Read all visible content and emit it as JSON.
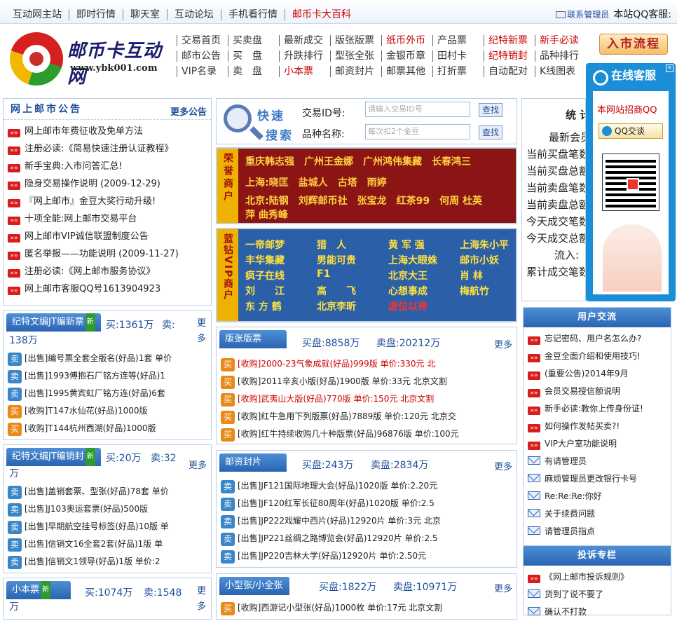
{
  "topbar": {
    "links": [
      "互动网主站",
      "即时行情",
      "聊天室",
      "互动论坛",
      "手机看行情",
      "邮币卡大百科"
    ],
    "admin_contact": "联系管理员",
    "qq_service": "本站QQ客服:"
  },
  "logo": {
    "title": "邮币卡互动网",
    "url": "www.ybk001.com"
  },
  "mainnav": {
    "rows": [
      [
        "交易首页",
        "买卖盘",
        "最新成交",
        "版张版票",
        "纸币外币",
        "产品票",
        "纪特新票",
        "新手必读"
      ],
      [
        "邮市公告",
        "买　盘",
        "升跌排行",
        "型张全张",
        "金银币章",
        "田村卡",
        "纪特销封",
        "品种排行"
      ],
      [
        "VIP名录",
        "卖　盘",
        "小本票",
        "邮资封片",
        "邮票其他",
        "打折票",
        "自动配对",
        "K线图表"
      ]
    ],
    "red": [
      "纸币外币",
      "纪特新票",
      "新手必读",
      "纪特销封",
      "小本票"
    ]
  },
  "entry_button": "入市流程",
  "notice": {
    "title": "网上邮市公告",
    "more": "更多公告",
    "items": [
      "网上邮市年费征收及免单方法",
      "注册必读:《简易快速注册认证教程》",
      "新手宝典:入市问答汇总!",
      "隐身交易操作说明 (2009-12-29)",
      "『网上邮市』金豆大奖行动升级!",
      "十项全能:网上邮市交易平台",
      "网上邮市VIP诚信联盟制度公告",
      "匿名举报——功能说明 (2009-11-27)",
      "注册必读:《网上邮市服务协议》",
      "网上邮市客服QQ号1613904923"
    ]
  },
  "search": {
    "quick": "快速",
    "search": "搜索",
    "id_label": "交易ID号:",
    "id_placeholder": "请输入交易ID号",
    "name_label": "品种名称:",
    "name_placeholder": "每次扣2个金豆",
    "btn": "查找"
  },
  "honor": {
    "band": "荣誉商户",
    "rows": [
      "重庆韩志强　广州王金娜　广州鸿伟集藏　长春鸿三",
      "上海:晓匡　盐城人　古塔　雨婷",
      "北京:陆钢　刘辉邮币社　张宝龙　红茶99　何周 杜英",
      "萍 曲秀峰"
    ]
  },
  "vip": {
    "band": "蓝钻VIP商户",
    "names": [
      "一帝邮梦",
      "猎　人",
      "黄 军 强",
      "上海朱小平",
      "丰华集藏",
      "男能可贵",
      "上海大眼姝",
      "邮市小妖",
      "疯子在线",
      "F1",
      "北京大王",
      "肖 林",
      "刘　　江",
      "高　　飞",
      "心想事成",
      "梅航竹",
      "东 方 鹤",
      "北京李昕",
      "虚位以待"
    ]
  },
  "stats": {
    "title": "统 计",
    "rows": [
      "最新会员:",
      "当前买盘笔数",
      "当前买盘总额",
      "当前卖盘笔数",
      "当前卖盘总额",
      "今天成交笔数",
      "今天成交总额",
      "流入:",
      "累计成交笔数"
    ]
  },
  "qq": {
    "title": "在线客服",
    "recruit": "本网站招商QQ",
    "btn": "QQ交谈"
  },
  "sections": {
    "jtxin": {
      "title": "纪特文编JT编新票",
      "badge": "新",
      "buy": "买:1361万",
      "sell": "卖:",
      "sell2": "138万",
      "more": "更多",
      "items": [
        [
          "sell",
          "[出售]编号票全套全版名(好品)1套 单价"
        ],
        [
          "sell",
          "[出售]1993傅抱石厂铭方连等(好品)1"
        ],
        [
          "sell",
          "[出售]1995黄宾虹厂铭方连(好品)6套"
        ],
        [
          "buy",
          "[收购]T147水仙花(好品)1000版"
        ],
        [
          "buy",
          "[收购]T144杭州西湖(好品)1000版"
        ]
      ]
    },
    "jtxiao": {
      "title": "纪特文编JT编销封",
      "badge": "新",
      "buy": "买:20万",
      "sell": "卖:32",
      "sell2": "万",
      "more": "更多",
      "items": [
        [
          "sell",
          "[出售]盖销套票、型张(好品)78套 单价"
        ],
        [
          "sell",
          "[出售]J103奥运套票(好品)500版"
        ],
        [
          "sell",
          "[出售]早期航空挂号标签(好品)10版 单"
        ],
        [
          "sell",
          "[出售]信销文16全套2套(好品)1版 单"
        ],
        [
          "sell",
          "[出售]信销文1领导(好品)1版 单价:2"
        ]
      ]
    },
    "xiaoben": {
      "title": "小本票",
      "badge": "新",
      "buy": "买:1074万",
      "sell": "卖:1548",
      "sell2": "万",
      "more": "更多"
    },
    "banzhang": {
      "title": "版张版票",
      "buy": "买盘:8858万",
      "sell": "卖盘:20212万",
      "more": "更多",
      "items": [
        [
          "buy",
          "[收购]2000-23气象成就(好品)999版 单价:330元 北",
          true
        ],
        [
          "buy",
          "[收购]2011辛亥小版(好品)1900版 单价:33元 北京文割",
          false
        ],
        [
          "buy",
          "[收购]武夷山大版(好品)770版 单价:150元 北京文割",
          true
        ],
        [
          "buy",
          "[收购]红牛急用下列版票(好品)7889版 单价:120元 北京交",
          false
        ],
        [
          "buy",
          "[收购]红牛持续收购几十种版票(好品)96876版 单价:100元",
          false
        ]
      ]
    },
    "youzi": {
      "title": "邮资封片",
      "buy": "买盘:243万",
      "sell": "卖盘:2834万",
      "more": "更多",
      "items": [
        [
          "sell",
          "[出售]JF121国际地理大会(好品)1020版 单价:2.20元"
        ],
        [
          "sell",
          "[出售]JF120红军长征80周年(好品)1020版 单价:2.5"
        ],
        [
          "sell",
          "[出售]JP222戏耀中西片(好品)12920片 单价:3元 北京"
        ],
        [
          "sell",
          "[出售]JP221丝绸之路博览会(好品)12920片 单价:2.5"
        ],
        [
          "sell",
          "[出售]JP220吉林大学(好品)12920片 单价:2.50元"
        ]
      ]
    },
    "xingzhang": {
      "title": "小型张/小全张",
      "buy": "买盘:1822万",
      "sell": "卖盘:10971万",
      "more": "更多",
      "items": [
        [
          "buy",
          "[收购]西游记小型张(好品)1000枚 单价:17元 北京文割"
        ]
      ]
    }
  },
  "user_exchange": {
    "title": "用户交流",
    "items": [
      [
        "arr",
        "忘记密码、用户名怎么办?"
      ],
      [
        "arr",
        "金豆全面介绍和使用技巧!"
      ],
      [
        "arr",
        "(重要公告)2014年9月"
      ],
      [
        "arr",
        "会员交易授信额说明"
      ],
      [
        "arr",
        "新手必读:教你上传身份证!"
      ],
      [
        "arr",
        "如何操作发帖买卖?!"
      ],
      [
        "arr",
        "VIP大户室功能说明"
      ],
      [
        "env",
        "有请管理员"
      ],
      [
        "env",
        "麻烦管理员更改银行卡号"
      ],
      [
        "env",
        "Re:Re:Re:你好"
      ],
      [
        "env",
        "关于续费问题"
      ],
      [
        "env",
        "请管理员指点"
      ]
    ]
  },
  "complaint": {
    "title": "投诉专栏",
    "items": [
      [
        "arr",
        "《网上邮市投诉规则》"
      ],
      [
        "env",
        "货到了说不要了"
      ],
      [
        "env",
        "确认不打款"
      ]
    ]
  }
}
